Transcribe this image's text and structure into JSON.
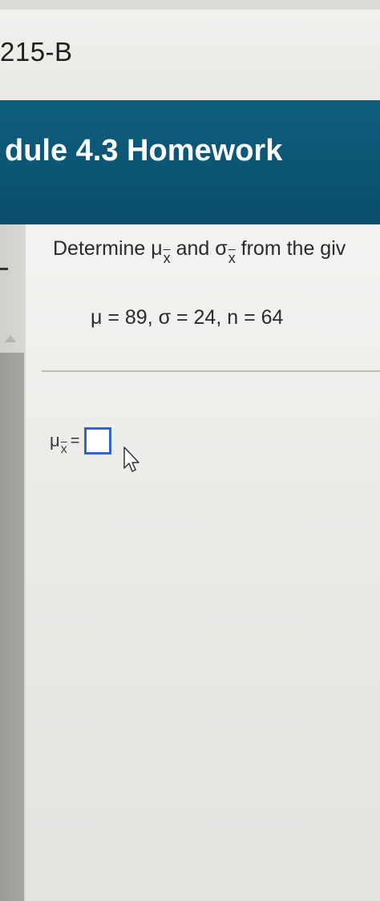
{
  "header": {
    "course_code": "215-B"
  },
  "banner": {
    "title": "dule 4.3 Homework"
  },
  "question": {
    "prefix": "Determine ",
    "mu": "μ",
    "sub_x": "x",
    "and": " and ",
    "sigma": "σ",
    "suffix": " from the giv",
    "givens": "μ = 89, σ = 24, n = 64"
  },
  "answer": {
    "mu": "μ",
    "sub_x": "x",
    "equals": "=",
    "value": ""
  },
  "colors": {
    "banner": "#0b5574",
    "input_border": "#2f66c7"
  }
}
